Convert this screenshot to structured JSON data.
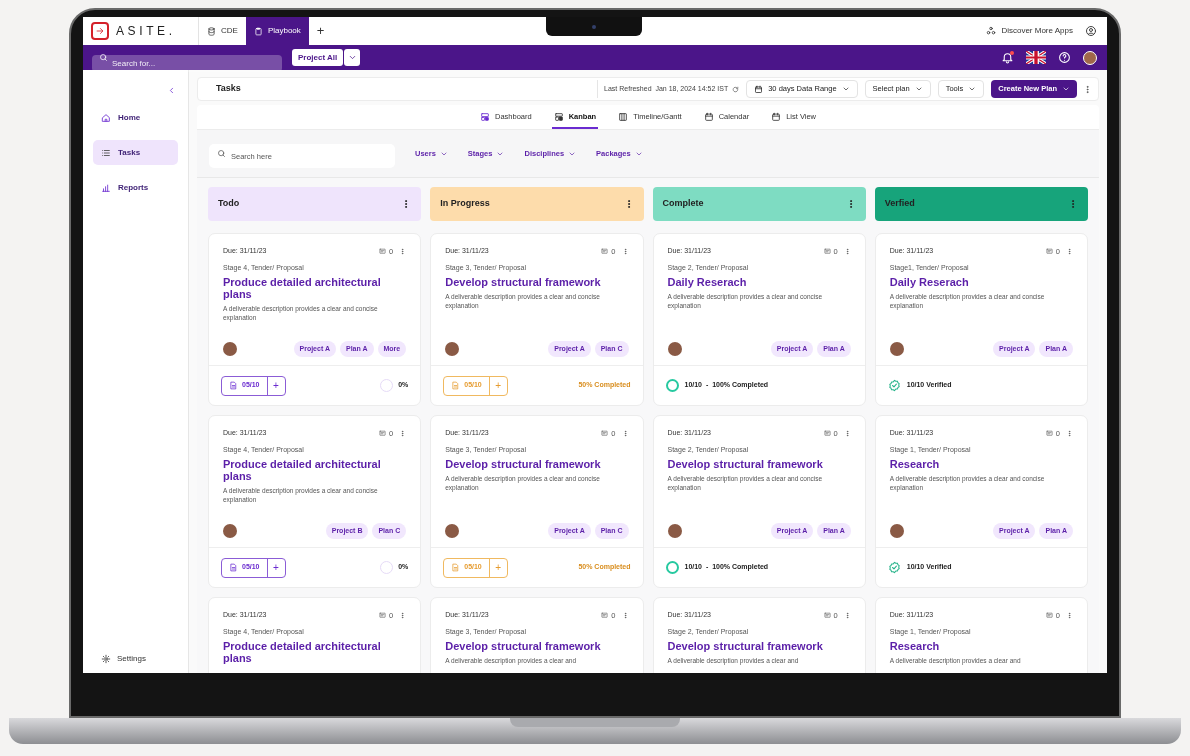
{
  "topbar": {
    "logo": "ASITE.",
    "tabs": [
      {
        "label": "CDE",
        "selected": false
      },
      {
        "label": "Playbook",
        "selected": true
      }
    ],
    "add_tab": "+",
    "discover": "Discover More Apps"
  },
  "navbar": {
    "search": {
      "placeholder": "Search for..."
    },
    "project": "Project All"
  },
  "sidebar": {
    "items": [
      {
        "label": "Home",
        "selected": false
      },
      {
        "label": "Tasks",
        "selected": true
      },
      {
        "label": "Reports",
        "selected": false
      }
    ],
    "footer": "Settings"
  },
  "header": {
    "title": "Tasks",
    "last_refreshed": "Last Refreshed  Jan 18, 2024 14:52 IST",
    "buttons": [
      {
        "label": "30 days Data Range",
        "kind": "calendar"
      },
      {
        "label": "Select plan",
        "kind": "dropdown"
      },
      {
        "label": "Tools",
        "kind": "dropdown"
      },
      {
        "label": "Create New Plan",
        "kind": "primary"
      }
    ]
  },
  "views": [
    {
      "label": "Dashboard",
      "selected": false
    },
    {
      "label": "Kanban",
      "selected": true
    },
    {
      "label": "Timeline/Gantt",
      "selected": false
    },
    {
      "label": "Calendar",
      "selected": false
    },
    {
      "label": "List View",
      "selected": false
    }
  ],
  "filters": {
    "search": {
      "placeholder": "Search here"
    },
    "dropdowns": [
      "Users",
      "Stages",
      "Disciplines",
      "Packages"
    ]
  },
  "columns": [
    {
      "title": "Todo",
      "color": "#efe4fc",
      "cards": [
        {
          "due": "Due: 31/11/23",
          "comments": "0",
          "stage": "Stage 4, Tender/ Proposal",
          "title": "Produce detailed architectural plans",
          "description": "A deliverable description provides a clear and concise explanation",
          "tags": [
            "Project A",
            "Plan A",
            "More"
          ],
          "footer": {
            "kind": "todo",
            "count": "05/10",
            "add": "+",
            "status": "0%"
          }
        },
        {
          "due": "Due: 31/11/23",
          "comments": "0",
          "stage": "Stage 4, Tender/ Proposal",
          "title": "Produce detailed architectural plans",
          "description": "A deliverable description provides a clear and concise explanation",
          "tags": [
            "Project B",
            "Plan C"
          ],
          "footer": {
            "kind": "todo",
            "count": "05/10",
            "add": "+",
            "status": "0%"
          }
        },
        {
          "due": "Due: 31/11/23",
          "comments": "0",
          "stage": "Stage 4, Tender/ Proposal",
          "title": "Produce detailed architectural plans"
        }
      ]
    },
    {
      "title": "In Progress",
      "color": "#fddcab",
      "cards": [
        {
          "due": "Due: 31/11/23",
          "comments": "0",
          "stage": "Stage 3, Tender/ Proposal",
          "title": "Develop structural framework",
          "description": "A deliverable description provides a clear and concise explanation",
          "tags": [
            "Project A",
            "Plan C"
          ],
          "footer": {
            "kind": "in_progress",
            "count": "05/10",
            "add": "+",
            "status": "50% Completed"
          }
        },
        {
          "due": "Due: 31/11/23",
          "comments": "0",
          "stage": "Stage 3, Tender/ Proposal",
          "title": "Develop structural framework",
          "description": "A deliverable description provides a clear and concise explanation",
          "tags": [
            "Project A",
            "Plan C"
          ],
          "footer": {
            "kind": "in_progress",
            "count": "05/10",
            "add": "+",
            "status": "50% Completed"
          }
        },
        {
          "due": "Due: 31/11/23",
          "comments": "0",
          "stage": "Stage 3, Tender/ Proposal",
          "title": "Develop structural framework",
          "description": "A deliverable description provides a clear and"
        }
      ]
    },
    {
      "title": "Complete",
      "color": "#7edcc2",
      "cards": [
        {
          "due": "Due: 31/11/23",
          "comments": "0",
          "stage": "Stage 2, Tender/ Proposal",
          "title": "Daily Reserach",
          "description": "A deliverable description provides a clear and concise explanation",
          "tags": [
            "Project A",
            "Plan A"
          ],
          "footer": {
            "kind": "complete",
            "status": "10/10  -  100% Completed"
          }
        },
        {
          "due": "Due: 31/11/23",
          "comments": "0",
          "stage": "Stage 2, Tender/ Proposal",
          "title": "Develop structural framework",
          "description": "A deliverable description provides a clear and concise explanation",
          "tags": [
            "Project A",
            "Plan A"
          ],
          "footer": {
            "kind": "complete",
            "status": "10/10  -  100% Completed"
          }
        },
        {
          "due": "Due: 31/11/23",
          "comments": "0",
          "stage": "Stage 2, Tender/ Proposal",
          "title": "Develop structural framework",
          "description": "A deliverable description provides a clear and"
        }
      ]
    },
    {
      "title": "Verfied",
      "color": "#17a47b",
      "cards": [
        {
          "due": "Due: 31/11/23",
          "comments": "0",
          "stage": "Stage1, Tender/ Proposal",
          "title": "Daily Reserach",
          "description": "A deliverable description provides a clear and concise explanation",
          "tags": [
            "Project A",
            "Plan A"
          ],
          "footer": {
            "kind": "verified",
            "status": "10/10 Verified"
          }
        },
        {
          "due": "Due: 31/11/23",
          "comments": "0",
          "stage": "Stage 1, Tender/ Proposal",
          "title": "Research",
          "description": "A deliverable description provides a clear and concise explanation",
          "tags": [
            "Project A",
            "Plan A"
          ],
          "footer": {
            "kind": "verified",
            "status": "10/10 Verified"
          }
        },
        {
          "due": "Due: 31/11/23",
          "comments": "0",
          "stage": "Stage 1, Tender/ Proposal",
          "title": "Research",
          "description": "A deliverable description provides a clear and"
        }
      ]
    }
  ]
}
